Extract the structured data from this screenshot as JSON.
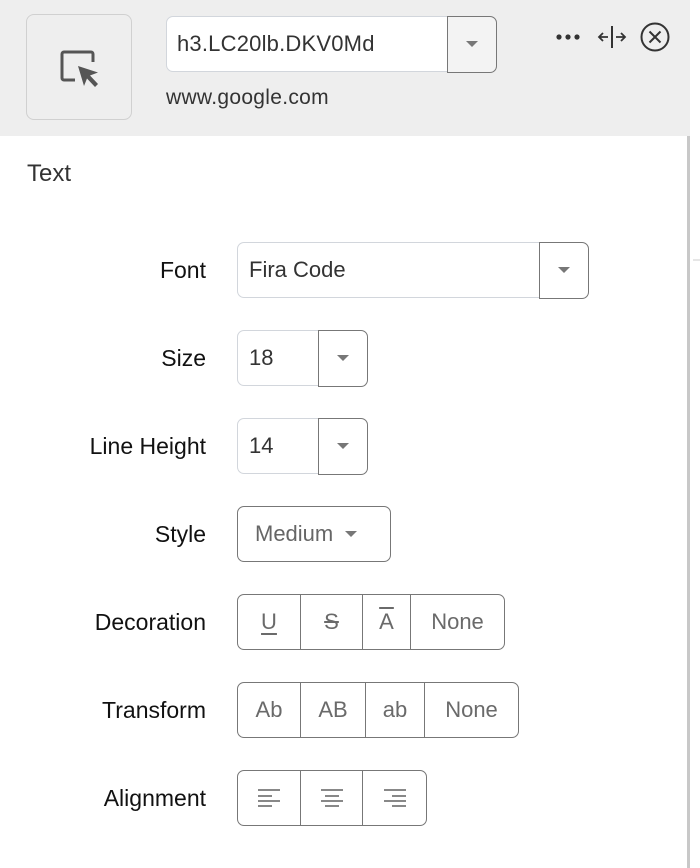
{
  "header": {
    "picker_icon": "element-picker-icon",
    "selector_value": "h3.LC20lb.DKV0Md",
    "domain": "www.google.com",
    "icons": [
      "more-icon",
      "expand-horizontal-icon",
      "close-circle-icon"
    ]
  },
  "section": {
    "title": "Text"
  },
  "fields": {
    "font": {
      "label": "Font",
      "value": "Fira Code"
    },
    "size": {
      "label": "Size",
      "value": "18"
    },
    "line_height": {
      "label": "Line Height",
      "value": "14"
    },
    "style": {
      "label": "Style",
      "value": "Medium"
    },
    "decoration": {
      "label": "Decoration",
      "options": [
        {
          "label": "U",
          "icon": "underline-icon"
        },
        {
          "label": "S",
          "icon": "strikethrough-icon"
        },
        {
          "label": "A",
          "icon": "overline-icon"
        },
        {
          "label": "None"
        }
      ]
    },
    "transform": {
      "label": "Transform",
      "options": [
        "Ab",
        "AB",
        "ab",
        "None"
      ]
    },
    "alignment": {
      "label": "Alignment",
      "options": [
        {
          "icon": "align-left-icon"
        },
        {
          "icon": "align-center-icon"
        },
        {
          "icon": "align-right-icon"
        }
      ]
    }
  },
  "colors": {
    "header_bg": "#eeeeee",
    "border_dark": "#777777",
    "border_light": "#d2d6dc",
    "text": "#333333"
  }
}
